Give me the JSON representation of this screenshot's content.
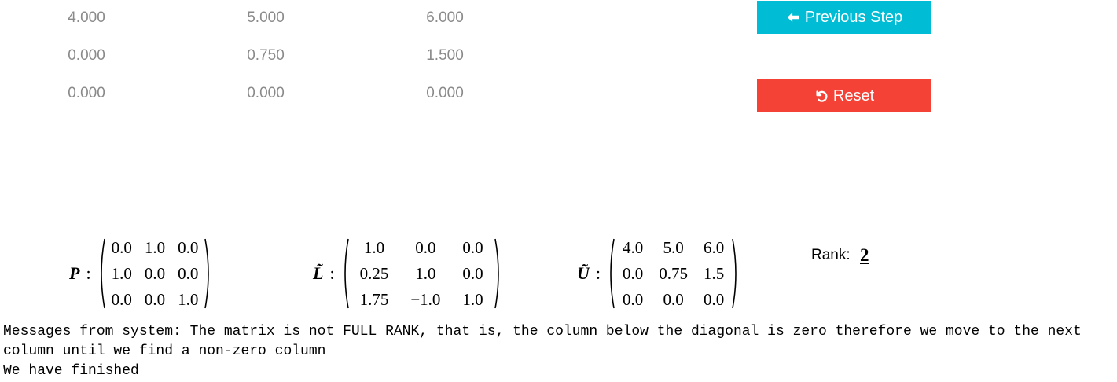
{
  "table": {
    "rows": [
      [
        "4.000",
        "5.000",
        "6.000"
      ],
      [
        "0.000",
        "0.750",
        "1.500"
      ],
      [
        "0.000",
        "0.000",
        "0.000"
      ]
    ]
  },
  "buttons": {
    "previous_label": "Previous Step",
    "reset_label": "Reset",
    "previous_icon": "arrow-left-icon",
    "reset_icon": "undo-icon",
    "previous_color": "#00bcd4",
    "reset_color": "#f44336"
  },
  "matrices": {
    "P": {
      "label": "P",
      "rows": [
        [
          "0.0",
          "1.0",
          "0.0"
        ],
        [
          "1.0",
          "0.0",
          "0.0"
        ],
        [
          "0.0",
          "0.0",
          "1.0"
        ]
      ]
    },
    "L": {
      "label": "L̃",
      "rows": [
        [
          "1.0",
          "0.0",
          "0.0"
        ],
        [
          "0.25",
          "1.0",
          "0.0"
        ],
        [
          "1.75",
          "−1.0",
          "1.0"
        ]
      ]
    },
    "U": {
      "label": "Ũ",
      "rows": [
        [
          "4.0",
          "5.0",
          "6.0"
        ],
        [
          "0.0",
          "0.75",
          "1.5"
        ],
        [
          "0.0",
          "0.0",
          "0.0"
        ]
      ]
    }
  },
  "rank": {
    "label": "Rank:",
    "value": "2"
  },
  "messages": {
    "line1": "Messages from system: The matrix is not FULL RANK, that is, the column below the diagonal is zero therefore we move to the next column until we find a non-zero column",
    "line2": "We have finished"
  }
}
